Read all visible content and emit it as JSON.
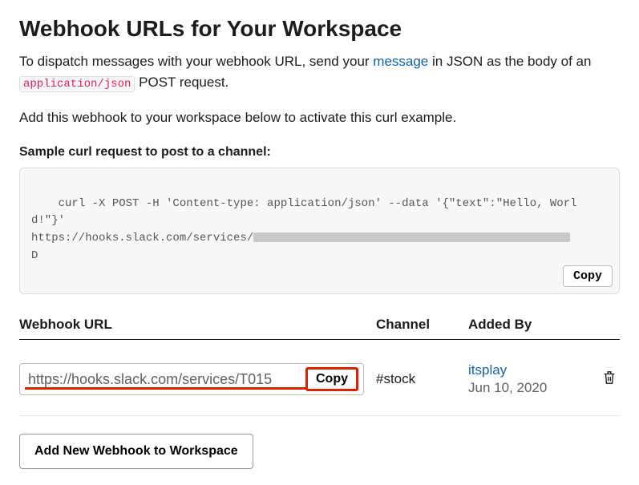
{
  "header": {
    "title": "Webhook URLs for Your Workspace"
  },
  "intro": {
    "part1": "To dispatch messages with your webhook URL, send your ",
    "link_text": "message",
    "part2": " in JSON as the body of an ",
    "code": "application/json",
    "part3": " POST request."
  },
  "activate_text": "Add this webhook to your workspace below to activate this curl example.",
  "sample": {
    "heading": "Sample curl request to post to a channel:",
    "code_line1": "curl -X POST -H 'Content-type: application/json' --data '{\"text\":\"Hello, World!\"}'",
    "code_line2_prefix": "https://hooks.slack.com/services/",
    "code_line3": "D",
    "copy_label": "Copy"
  },
  "table": {
    "headers": {
      "url": "Webhook URL",
      "channel": "Channel",
      "added_by": "Added By"
    },
    "row": {
      "url": "https://hooks.slack.com/services/T015",
      "copy_label": "Copy",
      "channel": "#stock",
      "added_by_name": "itsplay",
      "added_by_date": "Jun 10, 2020"
    }
  },
  "add_button_label": "Add New Webhook to Workspace"
}
